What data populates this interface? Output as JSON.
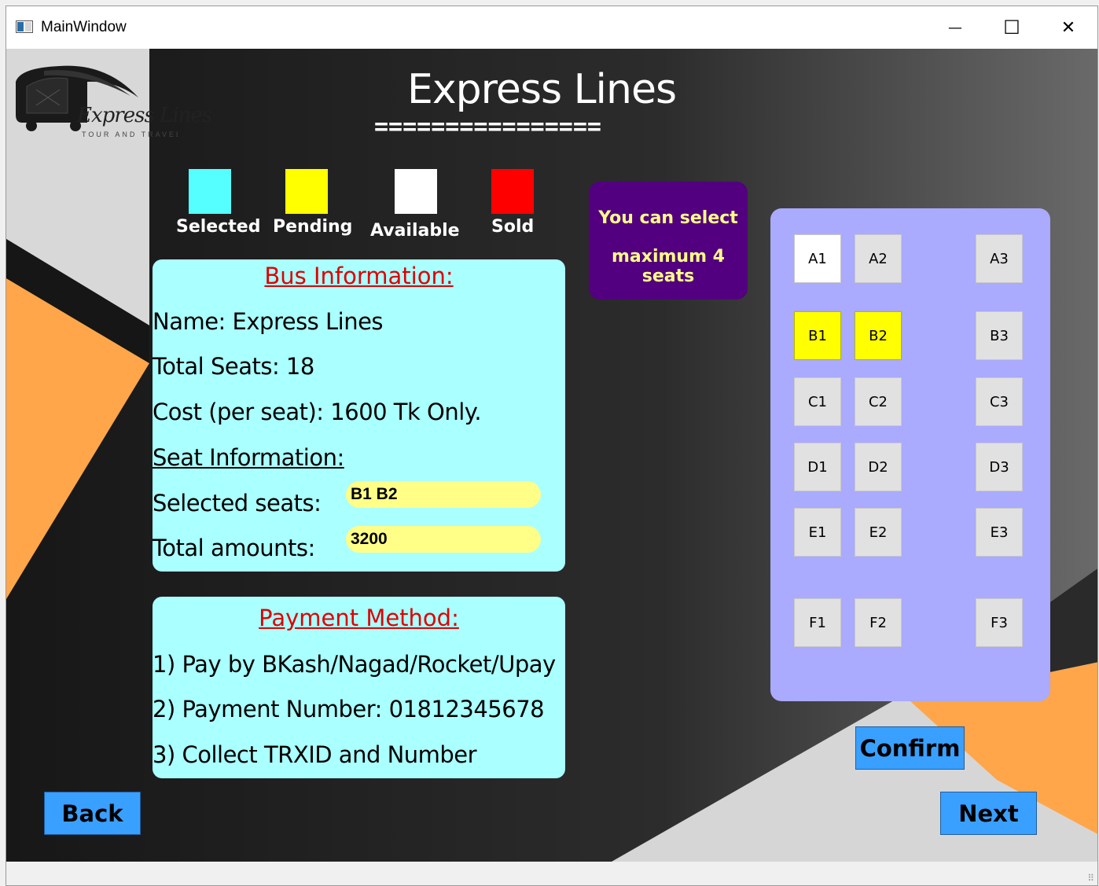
{
  "window": {
    "title": "MainWindow",
    "controls": {
      "minimize": "—",
      "maximize": "☐",
      "close": "✕"
    }
  },
  "header": {
    "title": "Express Lines",
    "underline": "================",
    "logo_text": "Express Lines",
    "logo_tagline": "TOUR AND TRAVELS"
  },
  "legend": [
    {
      "label": "Selected",
      "color": "#55ffff"
    },
    {
      "label": "Pending",
      "color": "#ffff00"
    },
    {
      "label": "Available",
      "color": "#ffffff"
    },
    {
      "label": "Sold",
      "color": "#ff0000"
    }
  ],
  "notice": {
    "line1": "You can select",
    "line2": "maximum 4 seats"
  },
  "bus_info": {
    "heading": "Bus Information:",
    "name": "Name: Express Lines",
    "total_seats": "Total Seats: 18",
    "cost": "Cost (per seat): 1600 Tk Only.",
    "seat_info_heading": "Seat Information:",
    "selected_label": "Selected seats:",
    "selected_value": "B1 B2",
    "total_label": "Total amounts:",
    "total_value": "3200"
  },
  "payment": {
    "heading": "Payment Method:",
    "line1": "1) Pay by BKash/Nagad/Rocket/Upay",
    "line2": "2) Payment Number: 01812345678",
    "line3": "3) Collect TRXID and Number"
  },
  "seats": [
    {
      "label": "A1",
      "status": "available",
      "color": "#ffffff"
    },
    {
      "label": "A2",
      "status": "default",
      "color": "#e1e1e1"
    },
    {
      "label": "A3",
      "status": "default",
      "color": "#e1e1e1"
    },
    {
      "label": "B1",
      "status": "pending",
      "color": "#ffff00"
    },
    {
      "label": "B2",
      "status": "pending",
      "color": "#ffff00"
    },
    {
      "label": "B3",
      "status": "default",
      "color": "#e1e1e1"
    },
    {
      "label": "C1",
      "status": "default",
      "color": "#e1e1e1"
    },
    {
      "label": "C2",
      "status": "default",
      "color": "#e1e1e1"
    },
    {
      "label": "C3",
      "status": "default",
      "color": "#e1e1e1"
    },
    {
      "label": "D1",
      "status": "default",
      "color": "#e1e1e1"
    },
    {
      "label": "D2",
      "status": "default",
      "color": "#e1e1e1"
    },
    {
      "label": "D3",
      "status": "default",
      "color": "#e1e1e1"
    },
    {
      "label": "E1",
      "status": "default",
      "color": "#e1e1e1"
    },
    {
      "label": "E2",
      "status": "default",
      "color": "#e1e1e1"
    },
    {
      "label": "E3",
      "status": "default",
      "color": "#e1e1e1"
    },
    {
      "label": "F1",
      "status": "default",
      "color": "#e1e1e1"
    },
    {
      "label": "F2",
      "status": "default",
      "color": "#e1e1e1"
    },
    {
      "label": "F3",
      "status": "default",
      "color": "#e1e1e1"
    }
  ],
  "buttons": {
    "confirm": "Confirm",
    "back": "Back",
    "next": "Next"
  }
}
